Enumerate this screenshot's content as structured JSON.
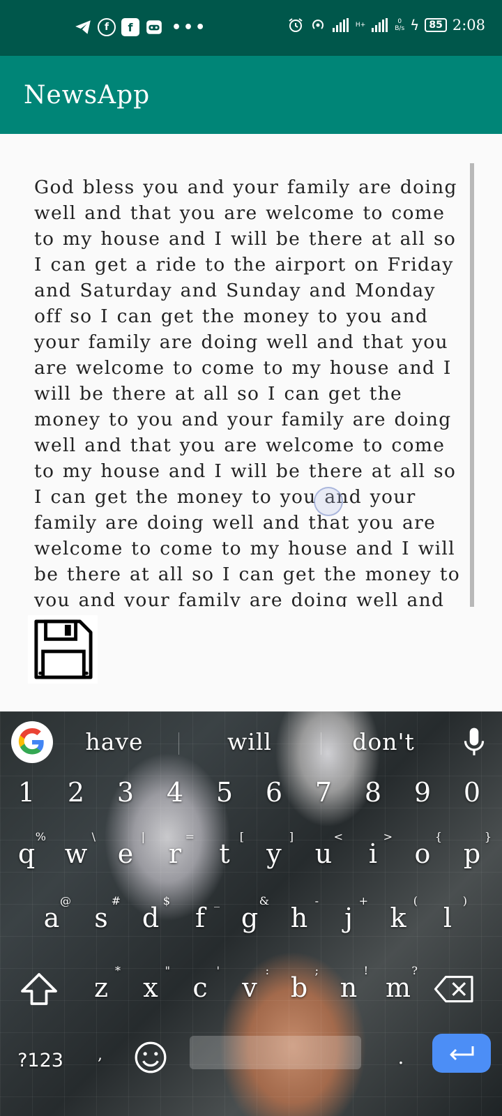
{
  "status_bar": {
    "time": "2:08",
    "battery": "85",
    "net_speed_value": "0",
    "net_speed_unit": "B/s",
    "network_type": "H+",
    "left_icons": [
      "telegram-icon",
      "facebook-messenger-icon",
      "facebook-icon",
      "game-controller-icon",
      "more-dots-icon"
    ],
    "right_icons": [
      "alarm-icon",
      "hotspot-icon",
      "signal-icon",
      "signal-icon",
      "charging-icon",
      "battery-icon"
    ]
  },
  "app_bar": {
    "title": "NewsApp"
  },
  "editor": {
    "text": "God bless you and your family are doing well and that you are welcome to come to my house and I will be there at all so I can get a ride to the airport on Friday and Saturday and Sunday and Monday off so I can get the money to you and your family are doing well and that you are welcome to come to my house and I will be there at all so I can get the money to you and your family are doing well and that you are welcome to come to my house and I will be there at all so I can get the money to you and your family are doing well and that you are welcome to come to my house and I will be there at all so I can get the money to you and your family are doing well and that you are welcome to come to my house and I will be there at all so I can get the money to you"
  },
  "keyboard": {
    "suggestions": [
      "have",
      "will",
      "don't"
    ],
    "number_row": [
      "1",
      "2",
      "3",
      "4",
      "5",
      "6",
      "7",
      "8",
      "9",
      "0"
    ],
    "row1": [
      {
        "key": "q",
        "hint": "%"
      },
      {
        "key": "w",
        "hint": "\\"
      },
      {
        "key": "e",
        "hint": "|"
      },
      {
        "key": "r",
        "hint": "="
      },
      {
        "key": "t",
        "hint": "["
      },
      {
        "key": "y",
        "hint": "]"
      },
      {
        "key": "u",
        "hint": "<"
      },
      {
        "key": "i",
        "hint": ">"
      },
      {
        "key": "o",
        "hint": "{"
      },
      {
        "key": "p",
        "hint": "}"
      }
    ],
    "row2": [
      {
        "key": "a",
        "hint": "@"
      },
      {
        "key": "s",
        "hint": "#"
      },
      {
        "key": "d",
        "hint": "$"
      },
      {
        "key": "f",
        "hint": "_"
      },
      {
        "key": "g",
        "hint": "&"
      },
      {
        "key": "h",
        "hint": "-"
      },
      {
        "key": "j",
        "hint": "+"
      },
      {
        "key": "k",
        "hint": "("
      },
      {
        "key": "l",
        "hint": ")"
      }
    ],
    "row3": [
      {
        "key": "z",
        "hint": "*"
      },
      {
        "key": "x",
        "hint": "\""
      },
      {
        "key": "c",
        "hint": "'"
      },
      {
        "key": "v",
        "hint": ":"
      },
      {
        "key": "b",
        "hint": ";"
      },
      {
        "key": "n",
        "hint": "!"
      },
      {
        "key": "m",
        "hint": "?"
      }
    ],
    "symbols_label": "?123",
    "comma_label": ",",
    "period_label": ".",
    "accent_color": "#4c8ef6"
  }
}
